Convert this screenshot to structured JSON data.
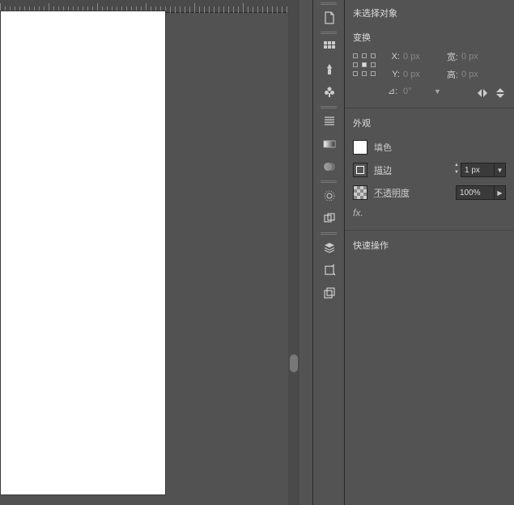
{
  "no_selection_label": "未选择对象",
  "transform": {
    "header": "变换",
    "x_label": "X:",
    "x_value": "0 px",
    "y_label": "Y:",
    "y_value": "0 px",
    "w_label": "宽:",
    "w_value": "0 px",
    "h_label": "高:",
    "h_value": "0 px",
    "rotate_icon": "⊿:",
    "rotate_value": "0°"
  },
  "appearance": {
    "header": "外观",
    "fill_label": "填色",
    "stroke_label": "描边",
    "stroke_value": "1 px",
    "opacity_label": "不透明度",
    "opacity_value": "100%",
    "fx_label": "fx."
  },
  "quick_actions": {
    "header": "快速操作"
  },
  "strip_icons": [
    "document",
    "swatches-grid",
    "brush",
    "symbol-club",
    "paragraph-lines",
    "gradient",
    "transparency-blob",
    "appearance-sun",
    "graphic-styles",
    "layers",
    "artboard",
    "links"
  ]
}
